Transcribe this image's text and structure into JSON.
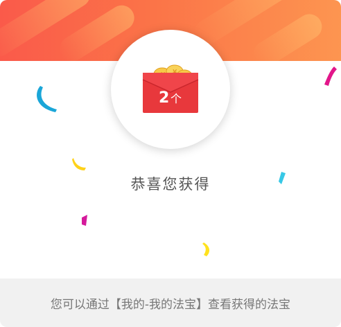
{
  "reward": {
    "count_label": "2",
    "unit": "个",
    "coin_glyph": "¥"
  },
  "message": {
    "congrats": "恭喜您获得"
  },
  "footer": {
    "hint": "您可以通过【我的-我的法宝】查看获得的法宝"
  },
  "colors": {
    "banner_start": "#fa5a4a",
    "banner_end": "#fd9550",
    "packet_red": "#e8383c",
    "coin_gold": "#f7c948"
  }
}
